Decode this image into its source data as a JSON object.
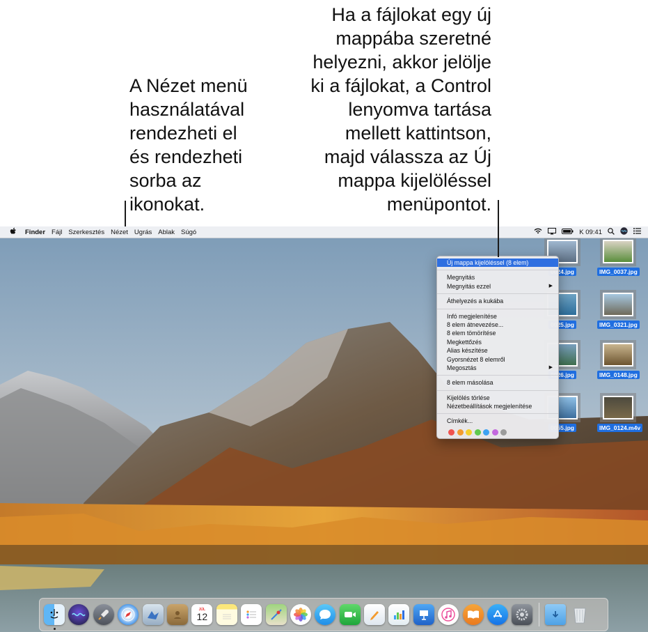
{
  "callouts": {
    "left": [
      "A Nézet menü",
      "használatával",
      "rendezheti el",
      "és rendezheti",
      "sorba az",
      "ikonokat."
    ],
    "right": [
      "Ha a fájlokat egy új",
      "mappába szeretné",
      "helyezni, akkor jelölje",
      "ki a fájlokat, a Control",
      "lenyomva tartása",
      "mellett kattintson,",
      "majd válassza az Új",
      "mappa kijelöléssel",
      "menüpontot."
    ]
  },
  "menubar": {
    "app": "Finder",
    "menus": [
      "Fájl",
      "Szerkesztés",
      "Nézet",
      "Ugrás",
      "Ablak",
      "Súgó"
    ],
    "clock": "K 09:41"
  },
  "files": [
    "0024.jpg",
    "IMG_0037.jpg",
    "0025.jpg",
    "IMG_0321.jpg",
    "0026.jpg",
    "IMG_0148.jpg",
    "0055.jpg",
    "IMG_0124.m4v"
  ],
  "context_menu": {
    "highlighted": "Új mappa kijelöléssel (8 elem)",
    "g1": [
      "Megnyitás",
      "Megnyitás ezzel"
    ],
    "g2": [
      "Áthelyezés a kukába"
    ],
    "g3": [
      "Infó megjelenítése",
      "8 elem átnevezése...",
      "8 elem tömörítése",
      "Megkettőzés",
      "Alias készítése",
      "Gyorsnézet 8 elemről",
      "Megosztás"
    ],
    "g4": [
      "8 elem másolása"
    ],
    "g5": [
      "Kijelölés törlése",
      "Nézetbeállítások megjelenítése"
    ],
    "g6": [
      "Címkék..."
    ]
  },
  "tag_colors": [
    "#f0534f",
    "#f39b2f",
    "#f4cf2d",
    "#5fc94f",
    "#3da2f2",
    "#c468de",
    "#9b9b9b"
  ],
  "calendar": {
    "month": "JÚL",
    "day": "12"
  },
  "dock_icons": [
    "finder-icon",
    "siri-icon",
    "launchpad-icon",
    "safari-icon",
    "mail-icon",
    "contacts-icon",
    "calendar-icon",
    "notes-icon",
    "reminders-icon",
    "maps-icon",
    "photos-icon",
    "messages-icon",
    "facetime-icon",
    "pages-icon",
    "numbers-icon",
    "keynote-icon",
    "itunes-icon",
    "ibooks-icon",
    "app-store-icon",
    "system-preferences-icon",
    "downloads-folder-icon",
    "trash-icon"
  ]
}
